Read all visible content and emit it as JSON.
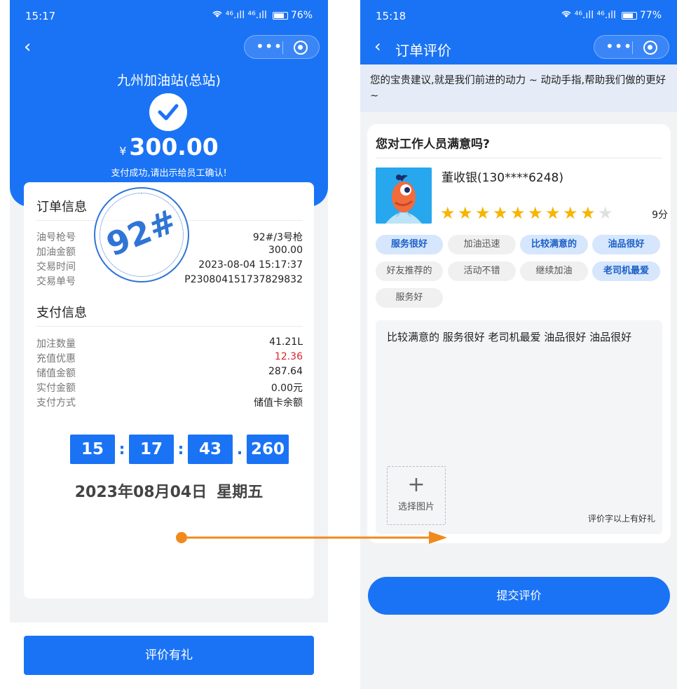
{
  "left": {
    "status": {
      "time": "15:17",
      "network": "⁴⁶.ıll ⁴⁶.ıll",
      "battery": "76%"
    },
    "station_name": "九州加油站(总站)",
    "amount": {
      "currency": "¥",
      "value": "300.00"
    },
    "pay_message": "支付成功,请出示给员工确认!",
    "stamp_text": "92#",
    "order_info": {
      "title": "订单信息",
      "rows": [
        {
          "label": "油号枪号",
          "value": "92#/3号枪"
        },
        {
          "label": "加油金额",
          "value": "300.00"
        },
        {
          "label": "交易时间",
          "value": "2023-08-04 15:17:37"
        },
        {
          "label": "交易单号",
          "value": "P230804151737829832"
        }
      ]
    },
    "payment_info": {
      "title": "支付信息",
      "rows": [
        {
          "label": "加注数量",
          "value": "41.21L"
        },
        {
          "label": "充值优惠",
          "value": "12.36"
        },
        {
          "label": "储值金额",
          "value": "287.64"
        },
        {
          "label": "实付金额",
          "value": "0.00元"
        },
        {
          "label": "支付方式",
          "value": "储值卡余额"
        }
      ]
    },
    "clock": {
      "hh": "15",
      "mm": "17",
      "ss": "43",
      "ms": "260",
      "sep1": ":",
      "sep2": ":",
      "sep3": "."
    },
    "date": {
      "day": "2023年08月04日",
      "weekday": "星期五"
    },
    "review_button": "评价有礼"
  },
  "right": {
    "status": {
      "time": "15:18",
      "network": "⁴⁶.ıll ⁴⁶.ıll",
      "battery": "77%"
    },
    "title": "订单评价",
    "notice": "您的宝贵建议,就是我们前进的动力 ~ 动动手指,帮助我们做的更好~",
    "question": "您对工作人员满意吗?",
    "staff": "董收银(130****6248)",
    "rating": {
      "value": 9,
      "max": 10,
      "label": "9分"
    },
    "tags": [
      {
        "label": "服务很好",
        "selected": true
      },
      {
        "label": "加油迅速",
        "selected": false
      },
      {
        "label": "比较满意的",
        "selected": true
      },
      {
        "label": "油品很好",
        "selected": true
      },
      {
        "label": "好友推荐的",
        "selected": false
      },
      {
        "label": "活动不错",
        "selected": false
      },
      {
        "label": "继续加油",
        "selected": false
      },
      {
        "label": "老司机最爱",
        "selected": true
      },
      {
        "label": "服务好",
        "selected": false
      }
    ],
    "comment": "比较满意的 服务很好 老司机最爱 油品很好 油品很好",
    "upload": {
      "plus": "+",
      "label": "选择图片"
    },
    "hint": "评价字以上有好礼",
    "submit_button": "提交评价"
  },
  "colors": {
    "primary": "#1a73f5",
    "accent_red": "#d7262c",
    "star": "#f7b500",
    "arrow": "#f08a1c",
    "stamp": "#2f75d6"
  }
}
